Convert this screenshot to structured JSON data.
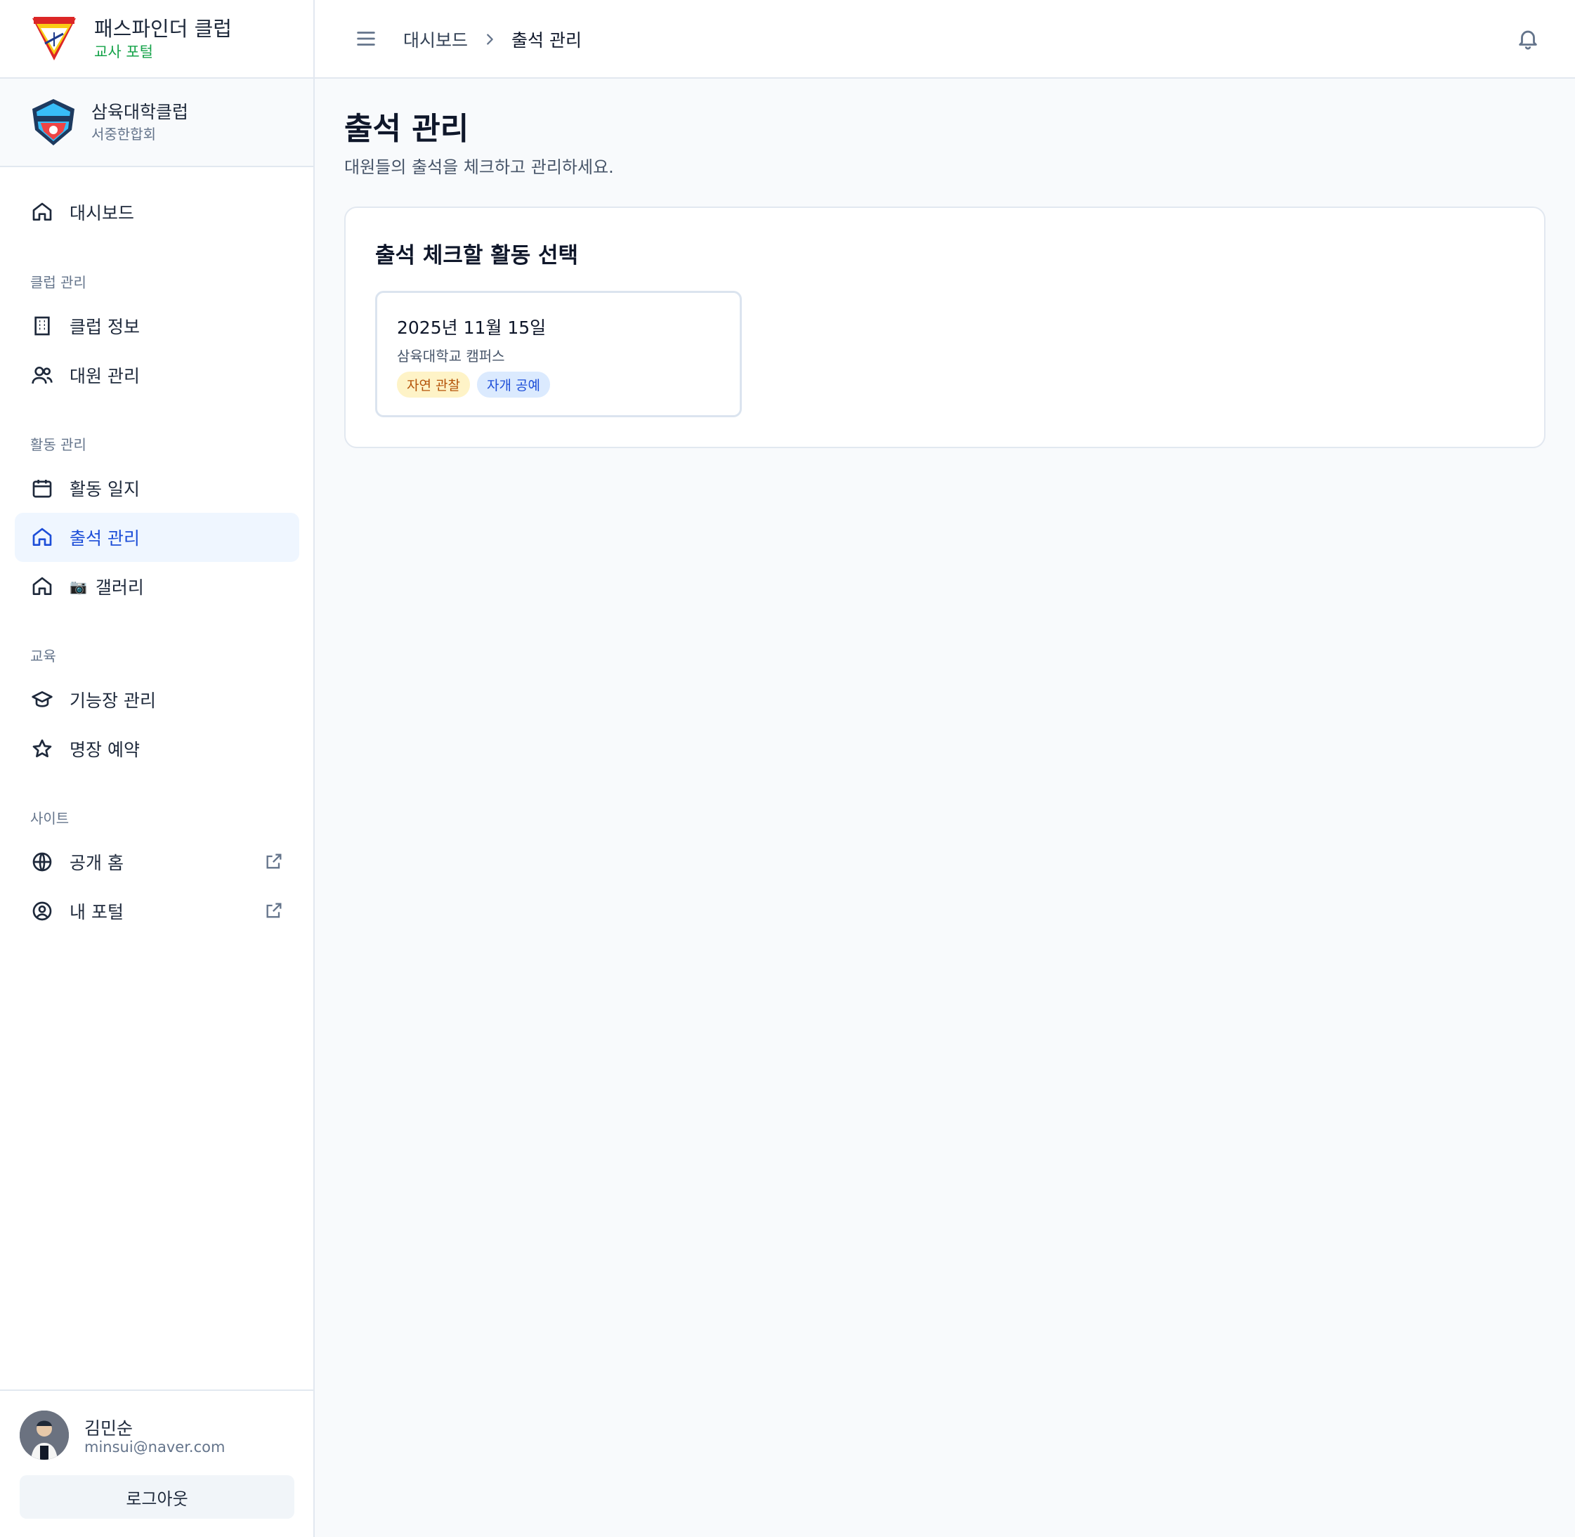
{
  "brand": {
    "title": "패스파인더 클럽",
    "subtitle": "교사 포털",
    "accent": "#16a34a"
  },
  "club": {
    "name": "삼육대학클럽",
    "region": "서중한합회"
  },
  "nav": {
    "dashboard": "대시보드",
    "sections": [
      "클럽 관리",
      "활동 관리",
      "교육",
      "사이트"
    ],
    "club_info": "클럽 정보",
    "members": "대원 관리",
    "activity_log": "활동 일지",
    "attendance": "출석 관리",
    "gallery": "갤러리",
    "gallery_icon": "📷",
    "badges": "기능장 관리",
    "honors": "명장 예약",
    "public_home": "공개 홈",
    "my_portal": "내 포털"
  },
  "user": {
    "name": "김민순",
    "email": "minsui@naver.com",
    "logout": "로그아웃"
  },
  "breadcrumb": {
    "home": "대시보드",
    "current": "출석 관리"
  },
  "page": {
    "title": "출석 관리",
    "description": "대원들의 출석을 체크하고 관리하세요."
  },
  "panel": {
    "title": "출석 체크할 활동 선택",
    "activities": [
      {
        "date": "2025년 11월 15일",
        "place": "삼육대학교 캠퍼스",
        "tags": [
          "자연 관찰",
          "자개 공예"
        ]
      }
    ]
  },
  "colors": {
    "active_bg": "#eff6ff",
    "active_text": "#1d4ed8",
    "tag_yellow": "#fef3c7",
    "tag_blue": "#dbeafe"
  }
}
